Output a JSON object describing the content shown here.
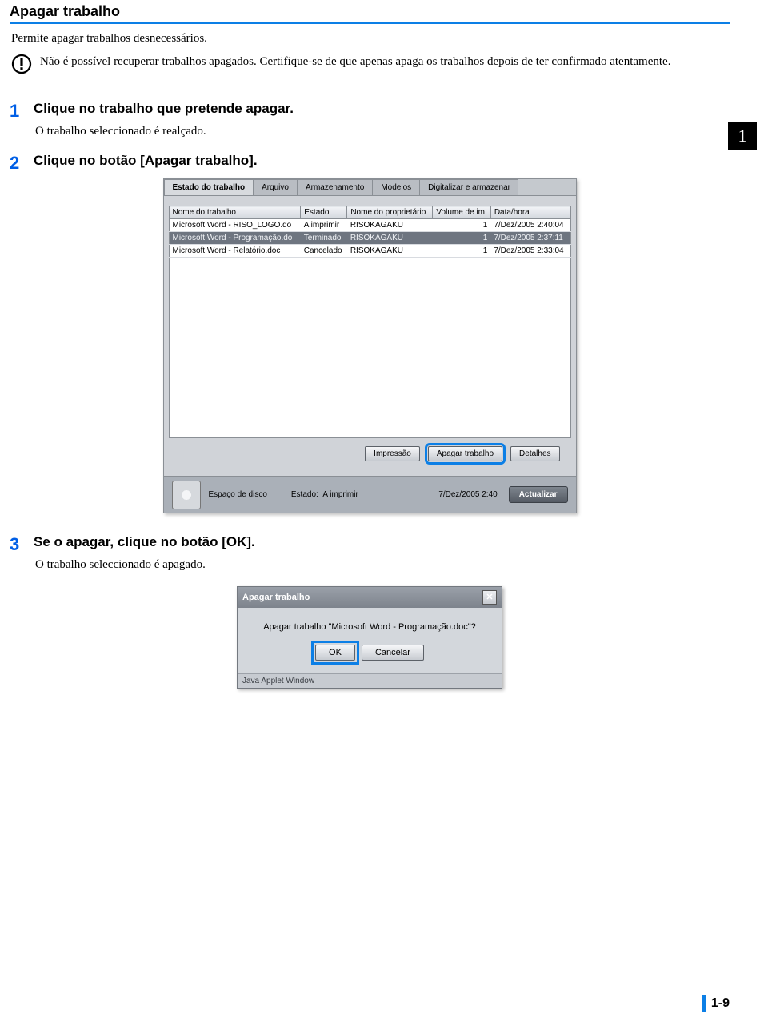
{
  "section_title": "Apagar trabalho",
  "intro": "Permite apagar trabalhos desnecessários.",
  "warning": "Não é possível recuperar trabalhos apagados. Certifique-se de que apenas apaga os trabalhos depois de ter confirmado atentamente.",
  "steps": {
    "s1": {
      "num": "1",
      "title": "Clique no trabalho que pretende apagar.",
      "sub": "O trabalho seleccionado é realçado."
    },
    "s2": {
      "num": "2",
      "title": "Clique no botão [Apagar trabalho]."
    },
    "s3": {
      "num": "3",
      "title": "Se o apagar, clique no botão [OK].",
      "sub": "O trabalho seleccionado é apagado."
    }
  },
  "sidetab": "1",
  "pagenum": "1-9",
  "app": {
    "tabs": [
      "Estado do trabalho",
      "Arquivo",
      "Armazenamento",
      "Modelos",
      "Digitalizar e armazenar"
    ],
    "headers": [
      "Nome do trabalho",
      "Estado",
      "Nome do proprietário",
      "Volume de im",
      "Data/hora"
    ],
    "rows": [
      {
        "name": "Microsoft Word - RISO_LOGO.do",
        "state": "A imprimir",
        "owner": "RISOKAGAKU",
        "vol": "1",
        "date": "7/Dez/2005 2:40:04",
        "selected": false
      },
      {
        "name": "Microsoft Word - Programação.do",
        "state": "Terminado",
        "owner": "RISOKAGAKU",
        "vol": "1",
        "date": "7/Dez/2005 2:37:11",
        "selected": true
      },
      {
        "name": "Microsoft Word - Relatório.doc",
        "state": "Cancelado",
        "owner": "RISOKAGAKU",
        "vol": "1",
        "date": "7/Dez/2005 2:33:04",
        "selected": false
      }
    ],
    "buttons": {
      "print": "Impressão",
      "delete": "Apagar trabalho",
      "details": "Detalhes"
    },
    "status": {
      "disklabel": "Espaço de disco",
      "statelabel": "Estado:",
      "statevalue": "A imprimir",
      "timestamp": "7/Dez/2005 2:40",
      "update": "Actualizar"
    }
  },
  "dialog": {
    "title": "Apagar trabalho",
    "message": "Apagar trabalho \"Microsoft Word - Programação.doc\"?",
    "ok": "OK",
    "cancel": "Cancelar",
    "footer": "Java Applet Window"
  }
}
